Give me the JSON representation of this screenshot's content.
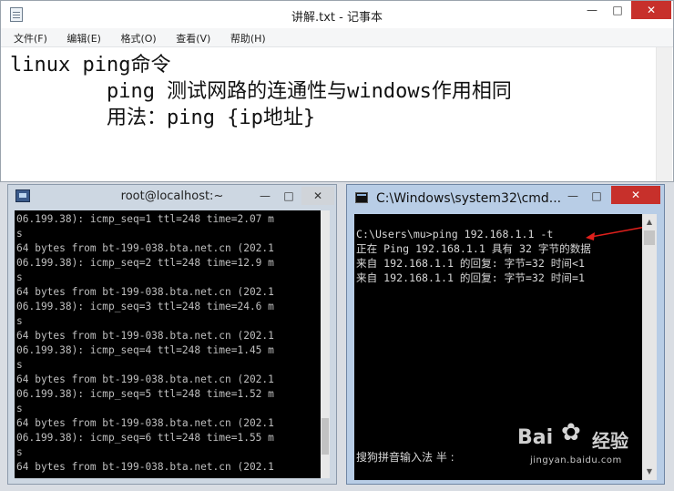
{
  "notepad": {
    "title": "讲解.txt - 记事本",
    "menu": [
      "文件(F)",
      "编辑(E)",
      "格式(O)",
      "查看(V)",
      "帮助(H)"
    ],
    "lines": [
      "linux ping命令",
      "        ping 测试网路的连通性与windows作用相同",
      "        用法：ping {ip地址}"
    ]
  },
  "putty": {
    "title": "root@localhost:~",
    "lines": [
      "06.199.38): icmp_seq=1 ttl=248 time=2.07 m",
      "s",
      "64 bytes from bt-199-038.bta.net.cn (202.1",
      "06.199.38): icmp_seq=2 ttl=248 time=12.9 m",
      "s",
      "64 bytes from bt-199-038.bta.net.cn (202.1",
      "06.199.38): icmp_seq=3 ttl=248 time=24.6 m",
      "s",
      "64 bytes from bt-199-038.bta.net.cn (202.1",
      "06.199.38): icmp_seq=4 ttl=248 time=1.45 m",
      "s",
      "64 bytes from bt-199-038.bta.net.cn (202.1",
      "06.199.38): icmp_seq=5 ttl=248 time=1.52 m",
      "s",
      "64 bytes from bt-199-038.bta.net.cn (202.1",
      "06.199.38): icmp_seq=6 ttl=248 time=1.55 m",
      "s",
      "64 bytes from bt-199-038.bta.net.cn (202.1"
    ]
  },
  "cmd": {
    "title": "C:\\Windows\\system32\\cmd...",
    "lines": [
      "C:\\Users\\mu>ping 192.168.1.1 -t",
      "",
      "正在 Ping 192.168.1.1 具有 32 字节的数据",
      "来自 192.168.1.1 的回复: 字节=32 时间<1",
      "来自 192.168.1.1 的回复: 字节=32 时间=1"
    ],
    "ime": "搜狗拼音输入法 半 :",
    "arrow_color": "#e0201c"
  },
  "watermark": {
    "brand_left": "Bai",
    "brand_right": "经验",
    "url": "jingyan.baidu.com"
  },
  "window_buttons": {
    "minimize": "—",
    "restore": "□",
    "close": "✕"
  }
}
